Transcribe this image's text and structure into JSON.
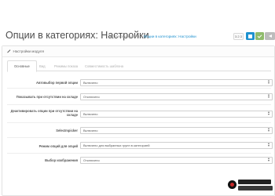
{
  "header": {
    "title": "Опции в категориях: Настройки",
    "breadcrumb": {
      "home": "Рекомендации",
      "separator": "/",
      "current": "Опции в категориях: Настройки"
    },
    "version": "3.2.3",
    "buttons": {
      "save": "save-icon",
      "apply": "check-icon",
      "cancel": "back-icon"
    }
  },
  "panel": {
    "heading": "Настройки модуля",
    "tabs": [
      "Основные",
      "Вид",
      "Режимы показа",
      "Совместимость шаблона"
    ],
    "active_tab": 0
  },
  "form": {
    "rows": [
      {
        "label": "Автовыбор первой опции",
        "value": "Включено"
      },
      {
        "label": "Показывать при отсутствии на складе",
        "value": "Отключено"
      },
      {
        "label": "Деактивировать опции при отсутствии на складе",
        "value": "Включено"
      },
      {
        "label": "Selectmpicker",
        "value": "Включено"
      },
      {
        "label": "Режим опций для опций",
        "value": "Включено для выбранных групп в категорией"
      },
      {
        "label": "Выбор изображения",
        "value": "Отключено"
      }
    ]
  },
  "colors": {
    "primary": "#1e91cf",
    "success": "#8fbb6c",
    "default": "#bcbcbc"
  }
}
